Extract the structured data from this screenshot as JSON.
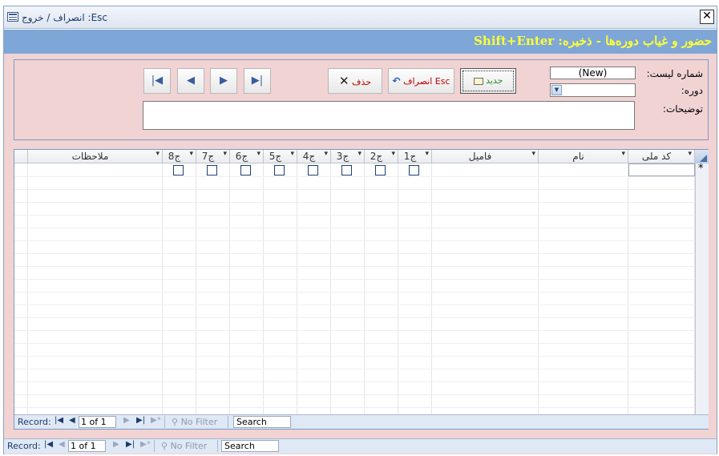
{
  "window": {
    "title": "انصراف / خروج :Esc",
    "close_label": "✕"
  },
  "header": {
    "heading": "حضور و غیاب دوره‌ها - ذخیره: Shift+Enter"
  },
  "form": {
    "list_number_label": "شماره لیست:",
    "list_number_value": "(New)",
    "course_label": "دوره:",
    "course_value": "",
    "description_label": "توضیحات:",
    "description_value": ""
  },
  "buttons": {
    "new_label": "جدید",
    "cancel_label": "انصراف Esc",
    "delete_label": "حذف",
    "first_icon": "first-record-icon",
    "prev_icon": "previous-record-icon",
    "next_icon": "next-record-icon",
    "last_icon": "last-record-icon"
  },
  "grid": {
    "columns": [
      "کد ملی",
      "نام",
      "فامیل",
      "ج1",
      "ج2",
      "ج3",
      "ج4",
      "ج5",
      "ج6",
      "ج7",
      "ج8",
      "ملاحظات"
    ],
    "new_row_marker": "*"
  },
  "subform_nav": {
    "record_label": "Record:",
    "position": "1 of 1",
    "filter_label": "No Filter",
    "search_label": "Search"
  },
  "main_nav": {
    "record_label": "Record:",
    "position": "1 of 1",
    "filter_label": "No Filter",
    "search_label": "Search"
  },
  "colors": {
    "header_band": "#7ea7d8",
    "header_text": "#ffff33",
    "form_background": "#f1d3d3",
    "new_button_text": "#2e8b2e",
    "cancel_button_text": "#c00000",
    "delete_button_text": "#c00000"
  }
}
